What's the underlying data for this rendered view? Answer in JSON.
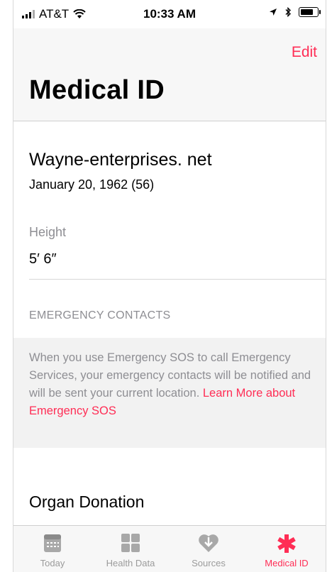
{
  "status_bar": {
    "carrier": "AT&T",
    "time": "10:33 AM"
  },
  "header": {
    "edit_label": "Edit",
    "title": "Medical ID"
  },
  "profile": {
    "name": "Wayne-enterprises. net",
    "birth": "January 20, 1962 (56)",
    "height_label": "Height",
    "height_value": "5′ 6″"
  },
  "emergency": {
    "section_label": "EMERGENCY CONTACTS",
    "description": "When you use Emergency SOS to call Emergency Services, your emergency contacts will be notified and will be sent your current location.",
    "link": "Learn More about Emergency SOS"
  },
  "organ_donation": {
    "label": "Organ Donation"
  },
  "tabs": [
    {
      "label": "Today",
      "icon": "calendar-icon"
    },
    {
      "label": "Health Data",
      "icon": "grid-icon"
    },
    {
      "label": "Sources",
      "icon": "heart-arrow-icon"
    },
    {
      "label": "Medical ID",
      "icon": "asterisk-icon",
      "active": true
    }
  ],
  "colors": {
    "accent": "#ff2d55",
    "inactive_tab": "#9b9b9b",
    "secondary_text": "#8e8e93"
  }
}
